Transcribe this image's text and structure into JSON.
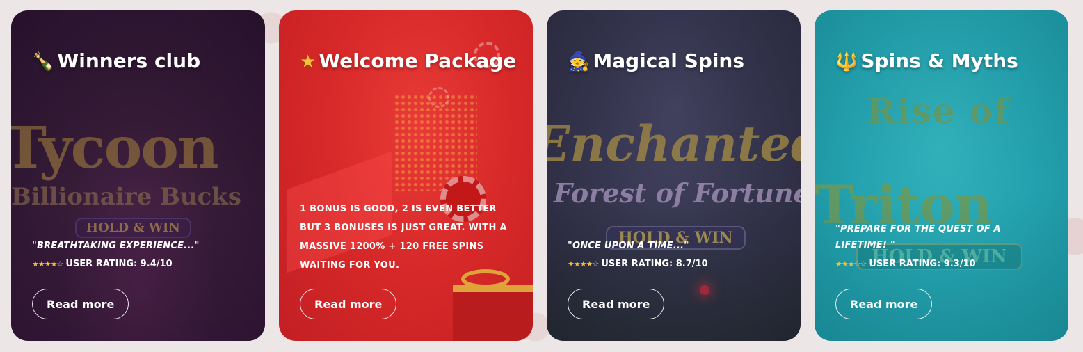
{
  "colors": {
    "page_bg": "#ece6e6",
    "card1": "#3a1f3a",
    "card2": "#d92a2a",
    "card3": "#3c3a55",
    "card4": "#23a4b0",
    "star_full": "#f2c230"
  },
  "cards": [
    {
      "icon": "champagne-icon",
      "icon_glyph": "🍾",
      "title": "Winners club",
      "quote": "\"BREATHTAKING EXPERIENCE...\"",
      "rating_text": "USER RATING: 9.4/10",
      "stars_full": 4,
      "button": "Read more",
      "art_title": "Tycoon",
      "art_sub": "Billionaire Bucks",
      "art_badge": "HOLD & WIN"
    },
    {
      "icon": "star-icon",
      "icon_glyph": "★",
      "title": "Welcome Package",
      "description": "1 BONUS IS GOOD, 2 IS EVEN BETTER BUT 3 BONUSES IS JUST GREAT. WITH A MASSIVE 1200% + 120 FREE SPINS WAITING FOR YOU.",
      "button": "Read more"
    },
    {
      "icon": "wizard-icon",
      "icon_glyph": "🧙",
      "title": "Magical Spins",
      "quote": "\"ONCE UPON A TIME...\"",
      "rating_text": "USER RATING: 8.7/10",
      "stars_full": 4,
      "button": "Read more",
      "art_title": "Enchanted",
      "art_sub": "Forest of Fortune",
      "art_badge": "HOLD & WIN"
    },
    {
      "icon": "trident-icon",
      "icon_glyph": "🔱",
      "title": "Spins & Myths",
      "quote": "\"PREPARE FOR THE QUEST OF A LIFETIME! \"",
      "rating_text": "USER RATING: 9.3/10",
      "stars_full": 3,
      "button": "Read more",
      "art_title": "Rise of",
      "art_sub": "Triton",
      "art_badge": "HOLD & WIN"
    }
  ]
}
